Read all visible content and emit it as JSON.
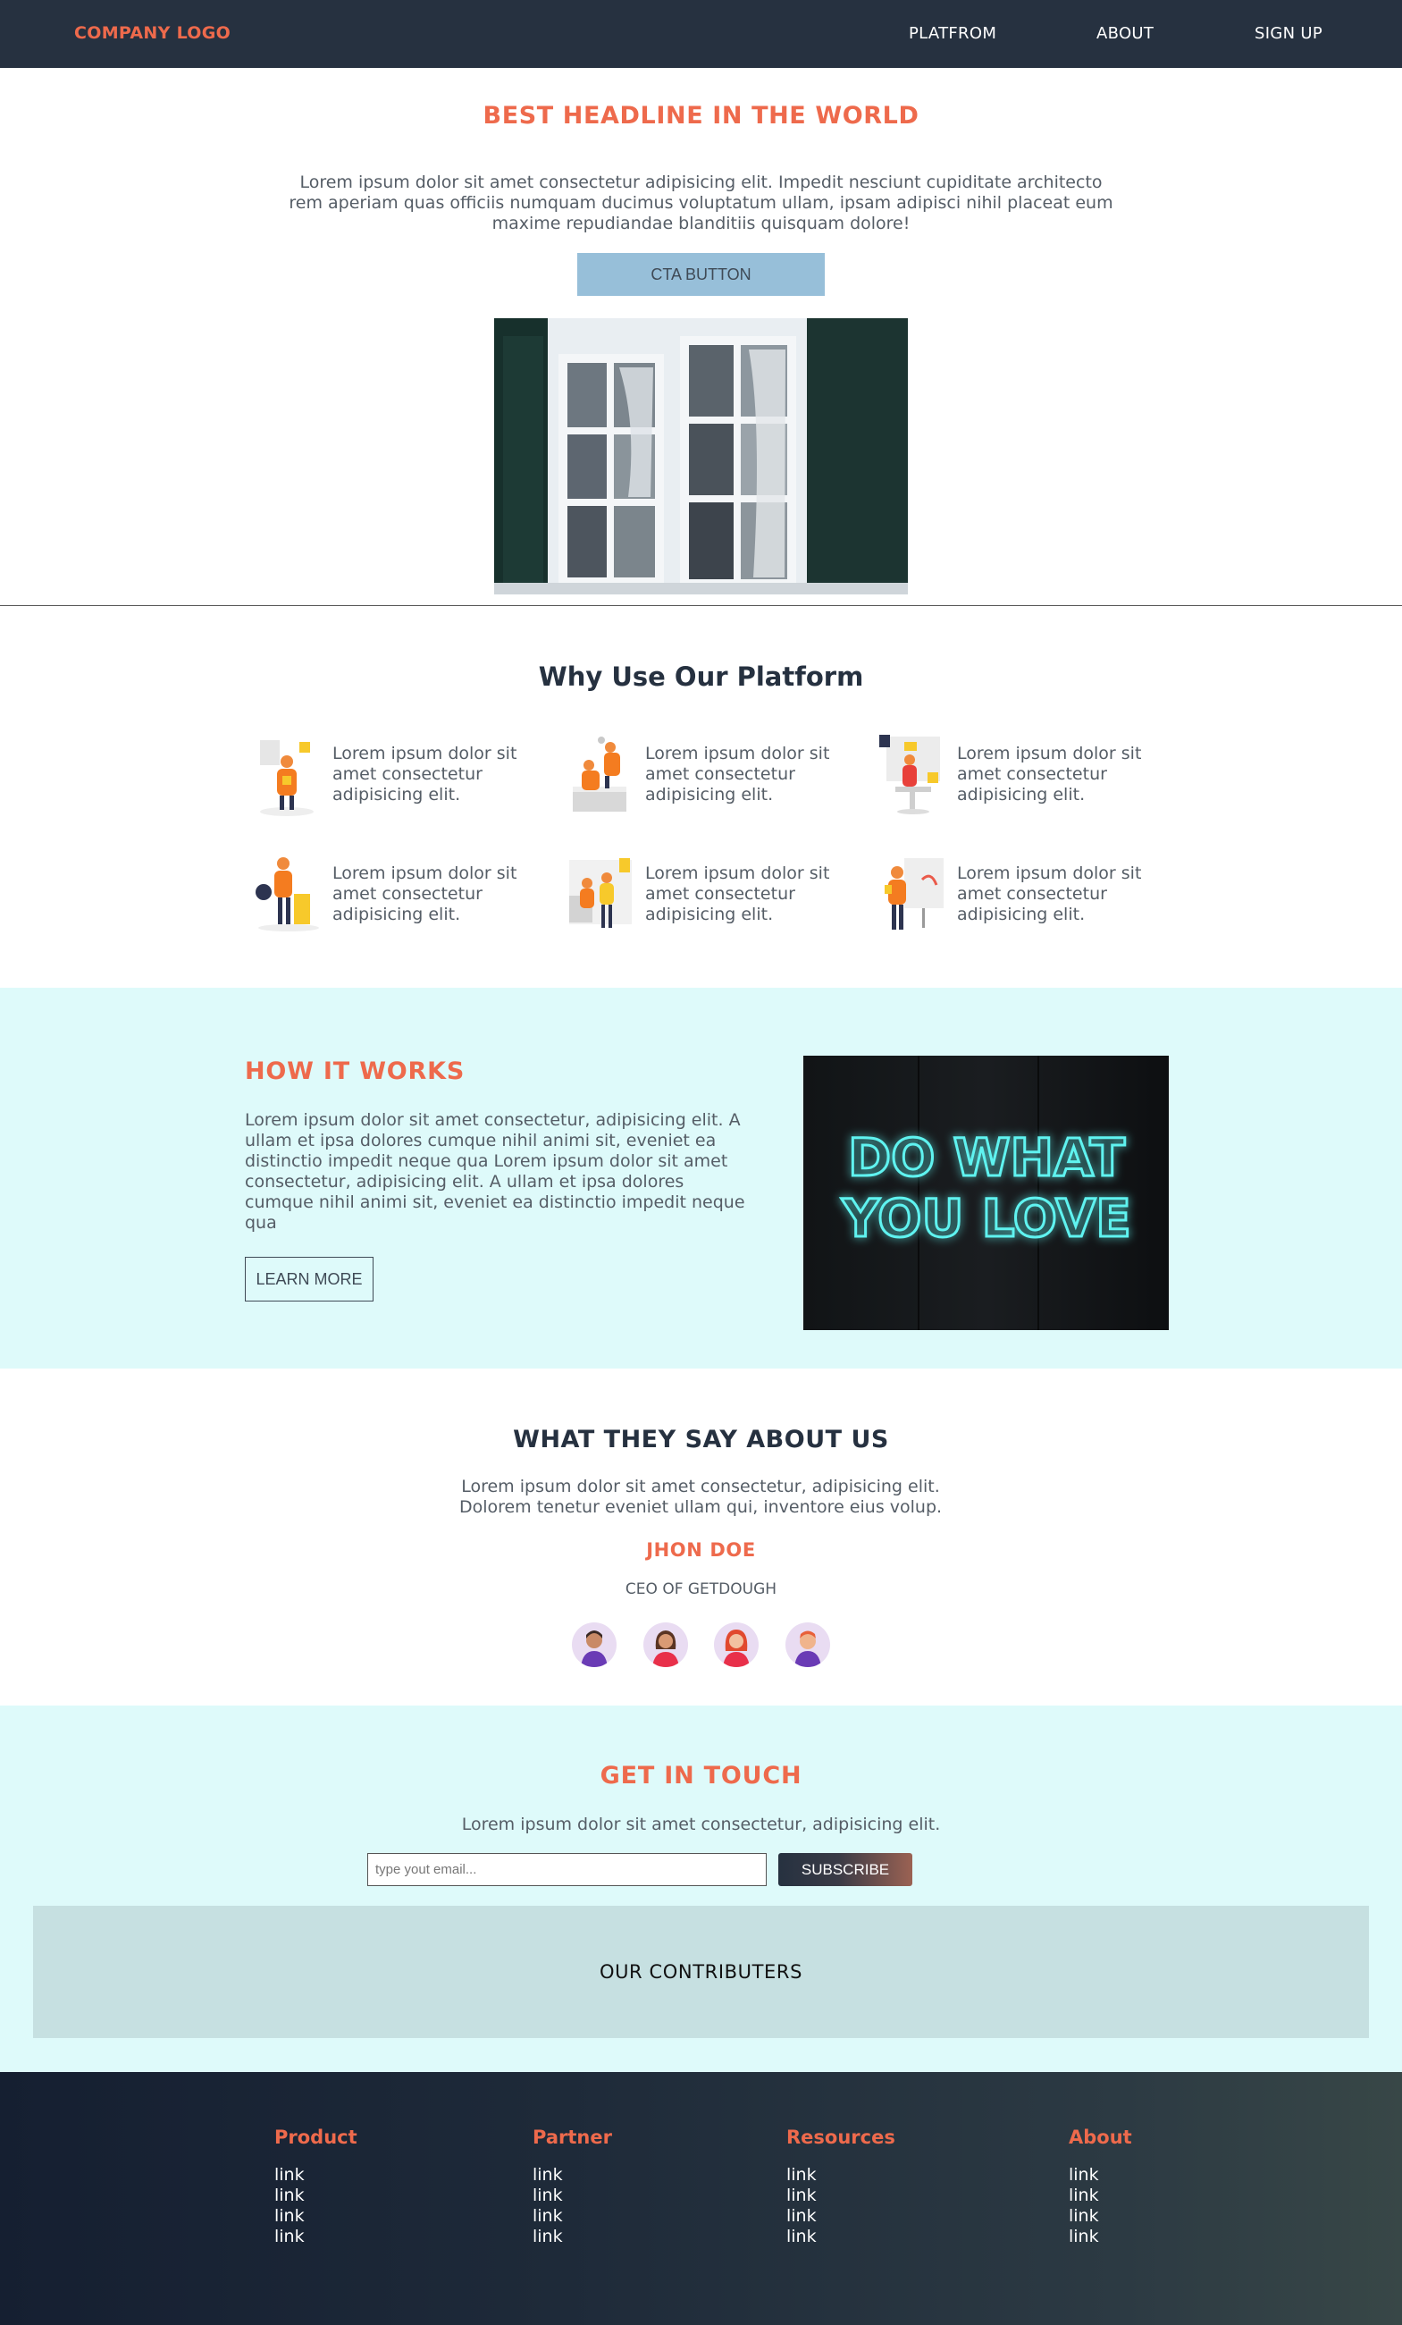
{
  "nav": {
    "logo": "COMPANY LOGO",
    "links": [
      "PLATFROM",
      "ABOUT",
      "SIGN UP"
    ]
  },
  "hero": {
    "title": "BEST HEADLINE IN THE WORLD",
    "text": "Lorem ipsum dolor sit amet consectetur adipisicing elit. Impedit nesciunt cupiditate architecto rem aperiam quas officiis numquam ducimus voluptatum ullam, ipsam adipisci nihil placeat eum maxime repudiandae blanditiis quisquam dolore!",
    "cta_label": "CTA BUTTON"
  },
  "why": {
    "title": "Why Use Our Platform",
    "features": [
      {
        "text": "Lorem ipsum dolor sit amet consectetur adipisicing elit."
      },
      {
        "text": "Lorem ipsum dolor sit amet consectetur adipisicing elit."
      },
      {
        "text": "Lorem ipsum dolor sit amet consectetur adipisicing elit."
      },
      {
        "text": "Lorem ipsum dolor sit amet consectetur adipisicing elit."
      },
      {
        "text": "Lorem ipsum dolor sit amet consectetur adipisicing elit."
      },
      {
        "text": "Lorem ipsum dolor sit amet consectetur adipisicing elit."
      }
    ]
  },
  "how": {
    "title": "HOW IT WORKS",
    "text": "Lorem ipsum dolor sit amet consectetur, adipisicing elit. A ullam et ipsa dolores cumque nihil animi sit, eveniet ea distinctio impedit neque qua Lorem ipsum dolor sit amet consectetur, adipisicing elit. A ullam et ipsa dolores cumque nihil animi sit, eveniet ea distinctio impedit neque qua",
    "button_label": "LEARN MORE",
    "neon_line1": "DO WHAT",
    "neon_line2": "YOU LOVE"
  },
  "testimonial": {
    "title": "WHAT THEY SAY ABOUT US",
    "text": "Lorem ipsum dolor sit amet consectetur, adipisicing elit. Dolorem tenetur eveniet ullam qui, inventore eius volup.",
    "name": "JHON DOE",
    "role": "CEO OF GETDOUGH"
  },
  "touch": {
    "title": "GET IN TOUCH",
    "text": "Lorem ipsum dolor sit amet consectetur, adipisicing elit.",
    "email_placeholder": "type yout email...",
    "subscribe_label": "SUBSCRIBE",
    "contributors_title": "OUR CONTRIBUTERS"
  },
  "footer": {
    "columns": [
      {
        "heading": "Product",
        "links": [
          "link",
          "link",
          "link",
          "link"
        ]
      },
      {
        "heading": "Partner",
        "links": [
          "link",
          "link",
          "link",
          "link"
        ]
      },
      {
        "heading": "Resources",
        "links": [
          "link",
          "link",
          "link",
          "link"
        ]
      },
      {
        "heading": "About",
        "links": [
          "link",
          "link",
          "link",
          "link"
        ]
      }
    ]
  },
  "colors": {
    "accent": "#ee6a4c",
    "nav_bg": "#263140",
    "cta_bg": "#97bfd9",
    "section_bg": "#defafa",
    "contributors_bg": "#c6e0e1"
  },
  "icons": [
    "window-photo",
    "neon-sign-photo",
    "avatar-icon"
  ]
}
